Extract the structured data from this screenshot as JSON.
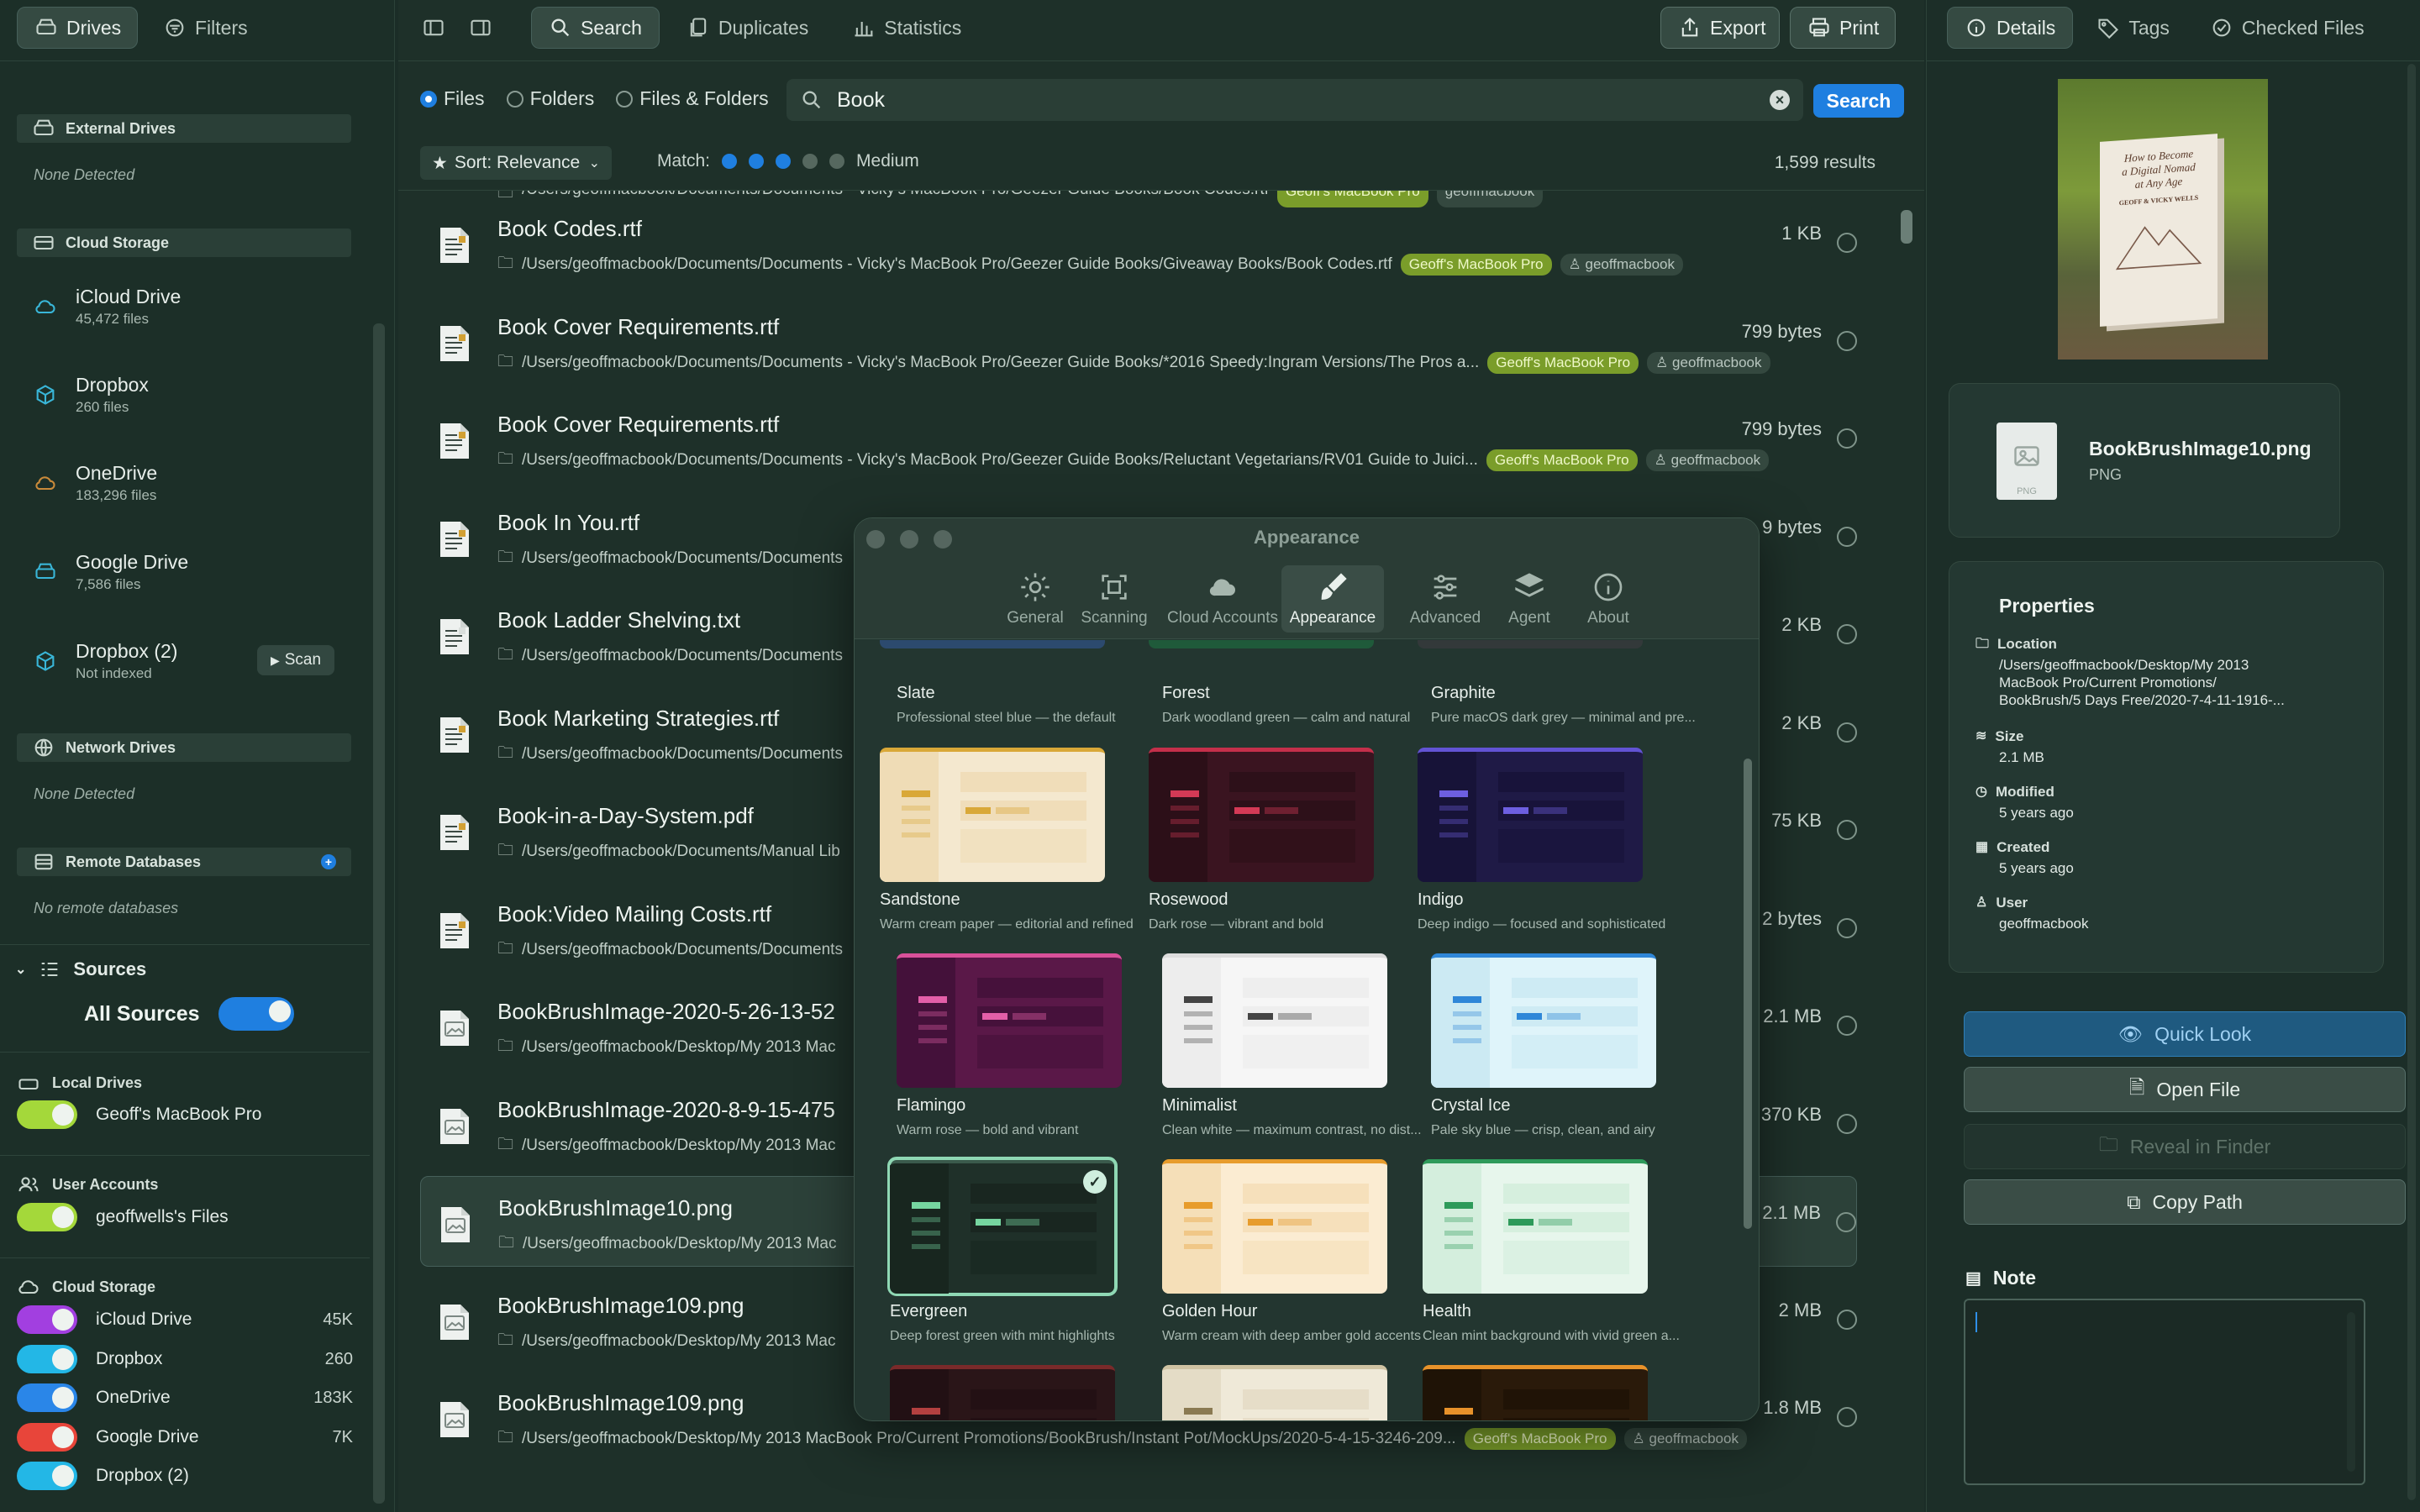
{
  "sidebar": {
    "tabs": {
      "drives": "Drives",
      "filters": "Filters"
    },
    "external": {
      "header": "External Drives",
      "empty": "None Detected"
    },
    "cloud": {
      "header": "Cloud Storage",
      "items": [
        {
          "name": "iCloud Drive",
          "count": "45,472 files",
          "icon": "cloud-icon"
        },
        {
          "name": "Dropbox",
          "count": "260 files",
          "icon": "dropbox-icon"
        },
        {
          "name": "OneDrive",
          "count": "183,296 files",
          "icon": "cloud-icon"
        },
        {
          "name": "Google Drive",
          "count": "7,586 files",
          "icon": "drive-icon"
        },
        {
          "name": "Dropbox (2)",
          "count": "Not indexed",
          "icon": "dropbox-icon"
        }
      ],
      "scan_label": "Scan"
    },
    "network": {
      "header": "Network Drives",
      "empty": "None Detected"
    },
    "remote": {
      "header": "Remote Databases",
      "empty": "No remote databases"
    },
    "sources": {
      "header": "Sources",
      "all_label": "All Sources",
      "local_header": "Local Drives",
      "local": [
        {
          "name": "Geoff's MacBook Pro",
          "color": "#a4d83a"
        }
      ],
      "users_header": "User Accounts",
      "users": [
        {
          "name": "geoffwells's Files",
          "color": "#a4d83a"
        }
      ],
      "cloud_header": "Cloud Storage",
      "cloud": [
        {
          "name": "iCloud Drive",
          "count": "45K",
          "color": "#a23fe0"
        },
        {
          "name": "Dropbox",
          "count": "260",
          "color": "#23b7e6"
        },
        {
          "name": "OneDrive",
          "count": "183K",
          "color": "#2a86e8"
        },
        {
          "name": "Google Drive",
          "count": "7K",
          "color": "#e8453a"
        },
        {
          "name": "Dropbox (2)",
          "count": "",
          "color": "#23b7e6"
        }
      ]
    }
  },
  "toolbar": {
    "search": "Search",
    "duplicates": "Duplicates",
    "statistics": "Statistics",
    "export": "Export",
    "print": "Print"
  },
  "filter": {
    "files": "Files",
    "folders": "Folders",
    "files_folders": "Files & Folders",
    "query": "Book",
    "search_button": "Search"
  },
  "sortbar": {
    "sort": "Sort: Relevance",
    "match_label": "Match:",
    "match_value": "Medium",
    "match_level": 3,
    "match_max": 5,
    "results": "1,599 results"
  },
  "results": [
    {
      "name": "Book Codes.rtf",
      "path": "/Users/geoffmacbook/Documents/Documents - Vicky's MacBook Pro/Geezer Guide Books/Giveaway Books/Book Codes.rtf",
      "size": "1 KB",
      "type": "rtf"
    },
    {
      "name": "Book Cover Requirements.rtf",
      "path": "/Users/geoffmacbook/Documents/Documents - Vicky's MacBook Pro/Geezer Guide Books/*2016 Speedy:Ingram Versions/The Pros a...",
      "size": "799 bytes",
      "type": "rtf"
    },
    {
      "name": "Book Cover Requirements.rtf",
      "path": "/Users/geoffmacbook/Documents/Documents - Vicky's MacBook Pro/Geezer Guide Books/Reluctant Vegetarians/RV01 Guide to Juici...",
      "size": "799 bytes",
      "type": "rtf"
    },
    {
      "name": "Book In You.rtf",
      "path": "/Users/geoffmacbook/Documents/Documents",
      "size": "9 bytes",
      "type": "rtf"
    },
    {
      "name": "Book Ladder Shelving.txt",
      "path": "/Users/geoffmacbook/Documents/Documents",
      "size": "2 KB",
      "type": "txt"
    },
    {
      "name": "Book Marketing Strategies.rtf",
      "path": "/Users/geoffmacbook/Documents/Documents",
      "size": "2 KB",
      "type": "rtf"
    },
    {
      "name": "Book-in-a-Day-System.pdf",
      "path": "/Users/geoffmacbook/Documents/Manual Lib",
      "size": "75 KB",
      "type": "pdf"
    },
    {
      "name": "Book:Video Mailing Costs.rtf",
      "path": "/Users/geoffmacbook/Documents/Documents",
      "size": "2 bytes",
      "type": "rtf"
    },
    {
      "name": "BookBrushImage-2020-5-26-13-52",
      "path": "/Users/geoffmacbook/Desktop/My 2013 Mac",
      "size": "2.1 MB",
      "type": "img"
    },
    {
      "name": "BookBrushImage-2020-8-9-15-475",
      "path": "/Users/geoffmacbook/Desktop/My 2013 Mac",
      "size": "370 KB",
      "type": "img"
    },
    {
      "name": "BookBrushImage10.png",
      "path": "/Users/geoffmacbook/Desktop/My 2013 Mac",
      "size": "2.1 MB",
      "type": "img"
    },
    {
      "name": "BookBrushImage109.png",
      "path": "/Users/geoffmacbook/Desktop/My 2013 Mac",
      "size": "2 MB",
      "type": "img"
    },
    {
      "name": "BookBrushImage109.png",
      "path": "/Users/geoffmacbook/Desktop/My 2013 MacBook Pro/Current Promotions/BookBrush/Instant Pot/MockUps/2020-5-4-15-3246-209...",
      "size": "1.8 MB",
      "type": "img"
    }
  ],
  "result_top_partial": "/Users/geoffmacbook/Documents/Documents - Vicky's MacBook Pro/Geezer Guide Books/Book Codes.rtf",
  "tags": {
    "mac": "Geoff's MacBook Pro",
    "user": "geoffmacbook",
    "user_partial": "acbook",
    "user_partial2": "ook"
  },
  "dialog": {
    "title": "Appearance",
    "tabs": [
      "General",
      "Scanning",
      "Cloud Accounts",
      "Appearance",
      "Advanced",
      "Agent",
      "About"
    ],
    "themes_row0": [
      {
        "name": "Slate",
        "desc": "Professional steel blue — the default"
      },
      {
        "name": "Forest",
        "desc": "Dark woodland green — calm and natural"
      },
      {
        "name": "Graphite",
        "desc": "Pure macOS dark grey — minimal and pre..."
      }
    ],
    "themes": [
      {
        "name": "Sandstone",
        "desc": "Warm cream paper — editorial and refined",
        "bg": "#f4e8cf",
        "side": "#efdcb6",
        "accent": "#d9a838",
        "top": "#d9a838"
      },
      {
        "name": "Rosewood",
        "desc": "Dark rose — vibrant and bold",
        "bg": "#3a1420",
        "side": "#2c0f18",
        "accent": "#d33a56",
        "top": "#c42f4a"
      },
      {
        "name": "Indigo",
        "desc": "Deep indigo — focused and sophisticated",
        "bg": "#1f1a46",
        "side": "#171338",
        "accent": "#6d5fe0",
        "top": "#6253d4"
      },
      {
        "name": "Flamingo",
        "desc": "Warm rose — bold and vibrant",
        "bg": "#5a1848",
        "side": "#44113a",
        "accent": "#e35fa8",
        "top": "#d9519a"
      },
      {
        "name": "Minimalist",
        "desc": "Clean white — maximum contrast, no dist...",
        "bg": "#f6f6f6",
        "side": "#ededed",
        "accent": "#444444",
        "top": "#dddddd"
      },
      {
        "name": "Crystal Ice",
        "desc": "Pale sky blue — crisp, clean, and airy",
        "bg": "#dff4fa",
        "side": "#cceaf3",
        "accent": "#2f87d8",
        "top": "#2f87d8"
      },
      {
        "name": "Evergreen",
        "desc": "Deep forest green with mint highlights",
        "bg": "#1f3029",
        "side": "#18261f",
        "accent": "#76d6a0",
        "top": "#3a5a4c"
      },
      {
        "name": "Golden Hour",
        "desc": "Warm cream with deep amber gold accents",
        "bg": "#fbecd2",
        "side": "#f5dfb8",
        "accent": "#e79c2c",
        "top": "#e79c2c"
      },
      {
        "name": "Health",
        "desc": "Clean mint background with vivid green a...",
        "bg": "#e7f6ec",
        "side": "#d4eedd",
        "accent": "#2e9a5a",
        "top": "#2e9a5a"
      }
    ],
    "themes_partial": [
      {
        "bg": "#2a1518",
        "side": "#221014",
        "accent": "#b44040",
        "top": "#7a2a2a"
      },
      {
        "bg": "#efe9d8",
        "side": "#e4dcc6",
        "accent": "#8a7a52",
        "top": "#cfc3a2"
      },
      {
        "bg": "#2a1a0a",
        "side": "#1f1306",
        "accent": "#e8922a",
        "top": "#e8922a"
      }
    ]
  },
  "details": {
    "tabs": {
      "details": "Details",
      "tags": "Tags",
      "checked": "Checked Files"
    },
    "file_name": "BookBrushImage10.png",
    "file_type": "PNG",
    "properties_title": "Properties",
    "location_label": "Location",
    "location": [
      "/Users/geoffmacbook/Desktop/My 2013",
      "MacBook Pro/Current Promotions/",
      "BookBrush/5 Days Free/2020-7-4-11-1916-..."
    ],
    "size_label": "Size",
    "size": "2.1 MB",
    "modified_label": "Modified",
    "modified": "5 years ago",
    "created_label": "Created",
    "created": "5 years ago",
    "user_label": "User",
    "user": "geoffmacbook",
    "actions": {
      "quick_look": "Quick Look",
      "open_file": "Open File",
      "reveal": "Reveal in Finder",
      "copy_path": "Copy Path"
    },
    "note_title": "Note",
    "book_cover_text": [
      "How to Become",
      "a Digital Nomad",
      "at Any Age",
      "GEOFF & VICKY WELLS"
    ]
  },
  "colors": {
    "accent": "#1f7fe0",
    "mac_tag": "#7a9d2a",
    "toggle_on": "#1f7fe0"
  }
}
